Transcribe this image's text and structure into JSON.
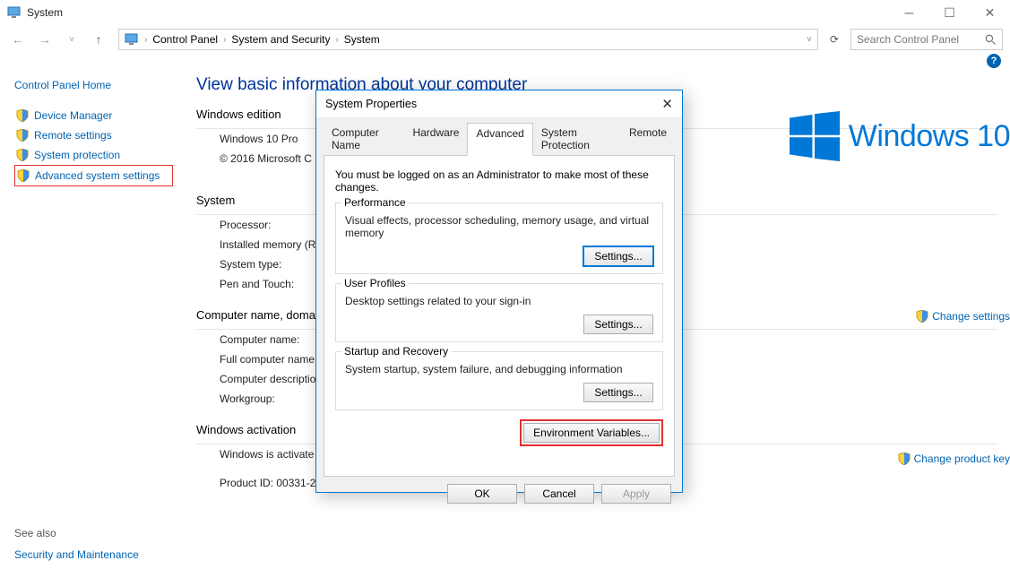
{
  "titlebar": {
    "title": "System"
  },
  "nav": {
    "crumbs": [
      "Control Panel",
      "System and Security",
      "System"
    ],
    "search_placeholder": "Search Control Panel"
  },
  "sidebar": {
    "home": "Control Panel Home",
    "items": [
      {
        "label": "Device Manager"
      },
      {
        "label": "Remote settings"
      },
      {
        "label": "System protection"
      },
      {
        "label": "Advanced system settings",
        "highlight": true
      }
    ],
    "see_also": "See also",
    "see_link": "Security and Maintenance"
  },
  "main": {
    "heading": "View basic information about your computer",
    "edition_h": "Windows edition",
    "edition_name": "Windows 10 Pro",
    "copyright": "© 2016 Microsoft C",
    "system_h": "System",
    "sys_rows": [
      "Processor:",
      "Installed memory (R",
      "System type:",
      "Pen and Touch:"
    ],
    "cnd_h": "Computer name, domai",
    "cnd_rows": [
      "Computer name:",
      "Full computer name",
      "Computer descriptio",
      "Workgroup:"
    ],
    "activation_h": "Windows activation",
    "act_status": "Windows is activate",
    "act_pid": "Product ID: 00331-2",
    "change_settings": "Change settings",
    "change_pkey": "Change product key",
    "win_brand": "Windows 10"
  },
  "dialog": {
    "title": "System Properties",
    "tabs": [
      "Computer Name",
      "Hardware",
      "Advanced",
      "System Protection",
      "Remote"
    ],
    "active_tab": 2,
    "note": "You must be logged on as an Administrator to make most of these changes.",
    "groups": [
      {
        "label": "Performance",
        "desc": "Visual effects, processor scheduling, memory usage, and virtual memory",
        "btn": "Settings..."
      },
      {
        "label": "User Profiles",
        "desc": "Desktop settings related to your sign-in",
        "btn": "Settings..."
      },
      {
        "label": "Startup and Recovery",
        "desc": "System startup, system failure, and debugging information",
        "btn": "Settings..."
      }
    ],
    "env_btn": "Environment Variables...",
    "ok": "OK",
    "cancel": "Cancel",
    "apply": "Apply"
  }
}
